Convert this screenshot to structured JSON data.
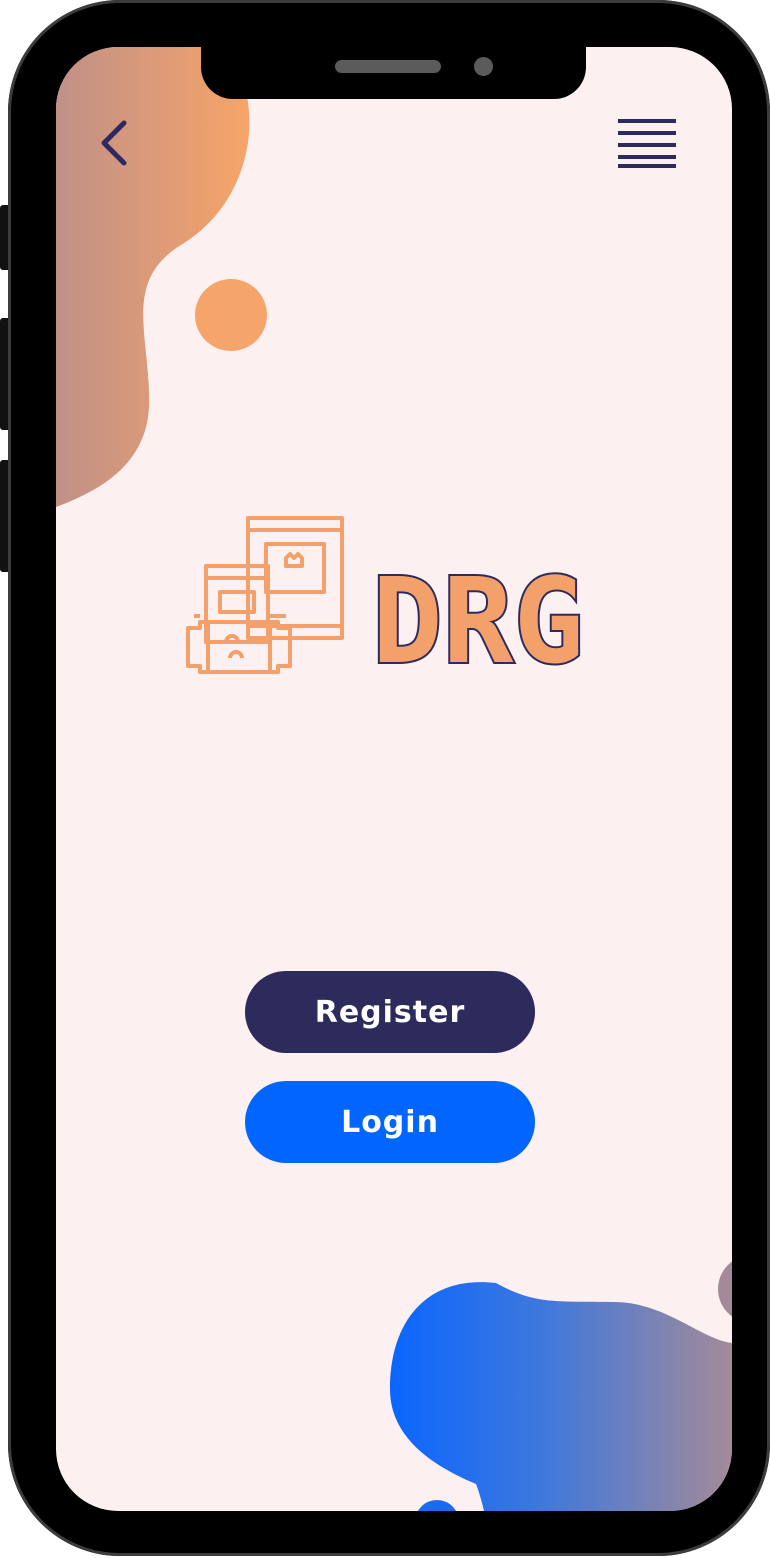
{
  "brand": {
    "name": "DRG",
    "outline_color": "#2d2b5c",
    "fill_color": "#f4a06a"
  },
  "header": {
    "back_icon": "chevron-left-icon",
    "menu_icon": "hamburger-menu-icon"
  },
  "auth": {
    "register_label": "Register",
    "login_label": "Login"
  },
  "colors": {
    "background": "#fcf0f0",
    "navy": "#2d2b5c",
    "blue": "#0066ff",
    "orange": "#f4a06a",
    "mauve": "#a58b99"
  }
}
